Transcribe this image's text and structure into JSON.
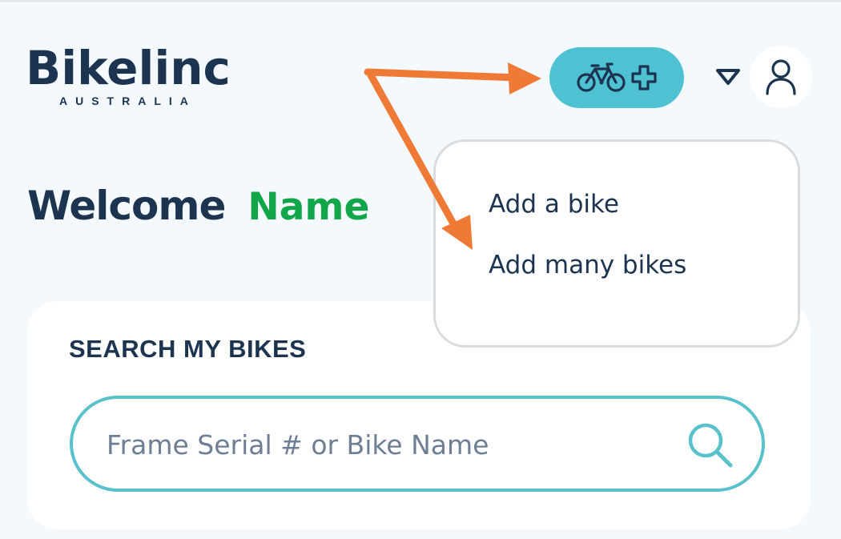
{
  "brand": {
    "name": "Bikelinc",
    "region": "AUSTRALIA"
  },
  "header": {
    "add_bike_icon": "bicycle-plus-icon",
    "dropdown_icon": "triangle-down-icon",
    "avatar_icon": "user-icon"
  },
  "welcome": {
    "greeting": "Welcome",
    "name": "Name"
  },
  "dropdown_menu": {
    "items": [
      {
        "label": "Add a bike"
      },
      {
        "label": "Add many bikes"
      }
    ]
  },
  "search": {
    "heading": "SEARCH MY BIKES",
    "placeholder": "Frame Serial # or Bike Name",
    "value": "",
    "icon": "search-icon"
  },
  "colors": {
    "brand_navy": "#1c3450",
    "accent_teal": "#4ec2d3",
    "name_green": "#12a64a",
    "annotation_orange": "#ef7a36",
    "page_bg": "#f4f9fd"
  }
}
